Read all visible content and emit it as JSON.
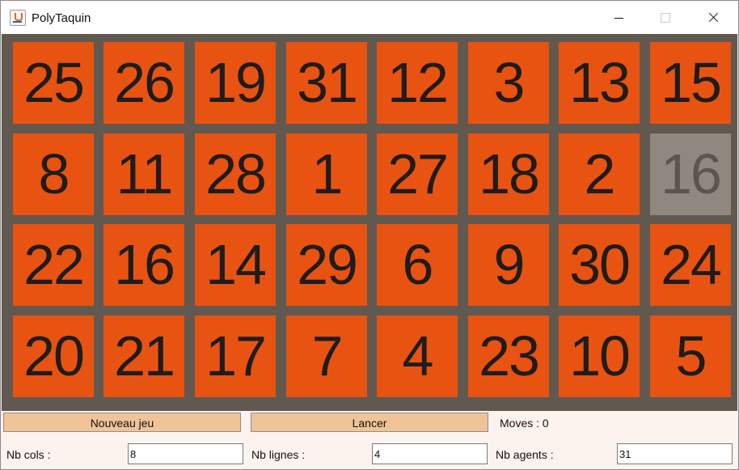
{
  "window": {
    "title": "PolyTaquin"
  },
  "board": {
    "cols": 8,
    "rows": 4,
    "tiles": [
      [
        "25",
        "26",
        "19",
        "31",
        "12",
        "3",
        "13",
        "15"
      ],
      [
        "8",
        "11",
        "28",
        "1",
        "27",
        "18",
        "2",
        "16"
      ],
      [
        "22",
        "16",
        "14",
        "29",
        "6",
        "9",
        "30",
        "24"
      ],
      [
        "20",
        "21",
        "17",
        "7",
        "4",
        "23",
        "10",
        "5"
      ]
    ],
    "empty_position": {
      "row": 1,
      "col": 7
    }
  },
  "controls": {
    "new_game_label": "Nouveau jeu",
    "launch_label": "Lancer",
    "moves_text": "Moves : 0"
  },
  "settings": {
    "cols_label": "Nb cols :",
    "cols_value": "8",
    "rows_label": "Nb lignes :",
    "rows_value": "4",
    "agents_label": "Nb agents :",
    "agents_value": "31"
  },
  "colors": {
    "tile": "#e85312",
    "empty_tile": "#8f8780",
    "board_background": "#615850",
    "button": "#f0c496",
    "panel": "#fdf3ee"
  }
}
